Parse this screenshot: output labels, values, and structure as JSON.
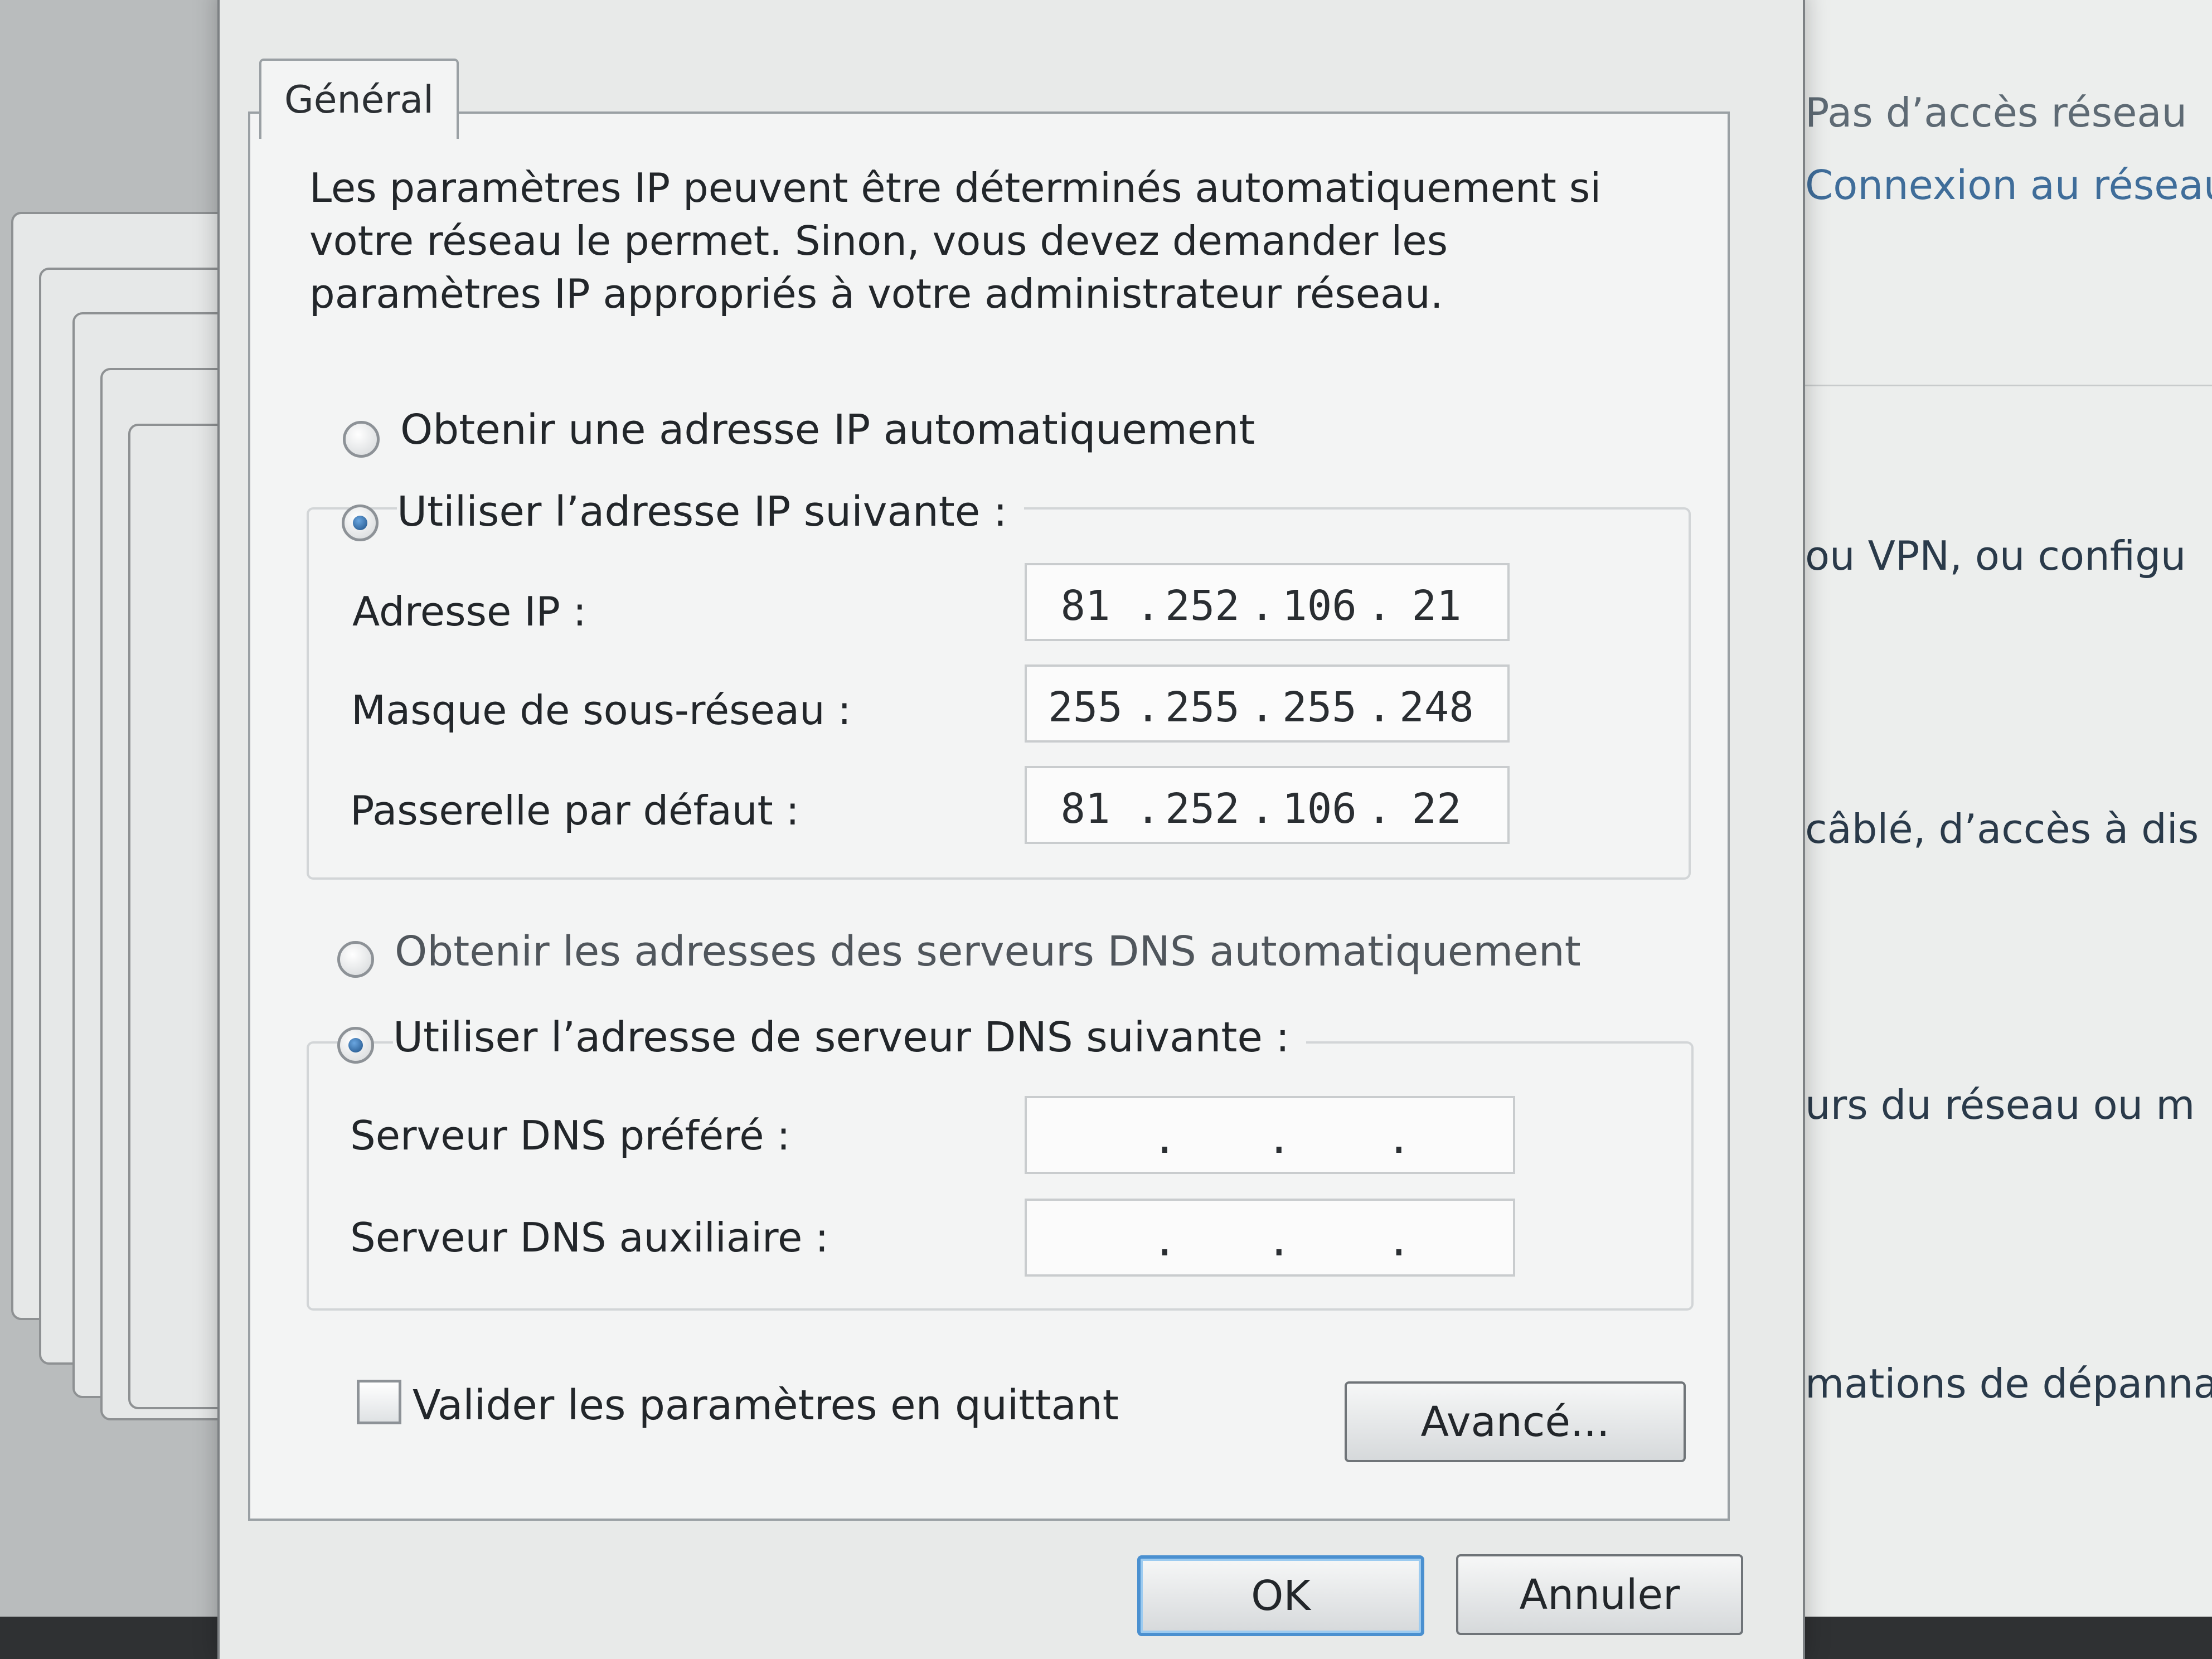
{
  "dialog": {
    "tab_label": "Général",
    "intro_text": "Les paramètres IP peuvent être déterminés automatiquement si votre réseau le permet. Sinon, vous devez demander les paramètres IP appropriés à votre administrateur réseau.",
    "ip_section": {
      "auto_label": "Obtenir une adresse IP automatiquement",
      "manual_label": "Utiliser l’adresse IP suivante :",
      "selected": "manual",
      "fields": [
        {
          "label": "Adresse IP :",
          "octets": [
            "81",
            "252",
            "106",
            "21"
          ]
        },
        {
          "label": "Masque de sous-réseau :",
          "octets": [
            "255",
            "255",
            "255",
            "248"
          ]
        },
        {
          "label": "Passerelle par défaut :",
          "octets": [
            "81",
            "252",
            "106",
            "22"
          ]
        }
      ]
    },
    "dns_section": {
      "auto_label": "Obtenir les adresses des serveurs DNS automatiquement",
      "manual_label": "Utiliser l’adresse de serveur DNS suivante :",
      "selected": "manual",
      "fields": [
        {
          "label": "Serveur DNS préféré :",
          "octets": [
            "",
            "",
            "",
            ""
          ]
        },
        {
          "label": "Serveur DNS auxiliaire :",
          "octets": [
            "",
            "",
            "",
            ""
          ]
        }
      ]
    },
    "validate_label": "Valider les paramètres en quittant",
    "validate_checked": false,
    "advanced_button": "Avancé...",
    "ok_button": "OK",
    "cancel_button": "Annuler"
  },
  "background_window": {
    "lines": [
      "Pas d’accès réseau",
      "Connexion au réseau",
      "ou VPN, ou configu",
      "câblé, d’accès à dis",
      "urs du réseau ou m",
      "mations de dépanna"
    ]
  },
  "colors": {
    "dialog_bg": "#e8eae9",
    "panel_bg": "#f3f4f4",
    "radio_selected": "#1d4f85",
    "default_button_border": "#4a90d0"
  }
}
